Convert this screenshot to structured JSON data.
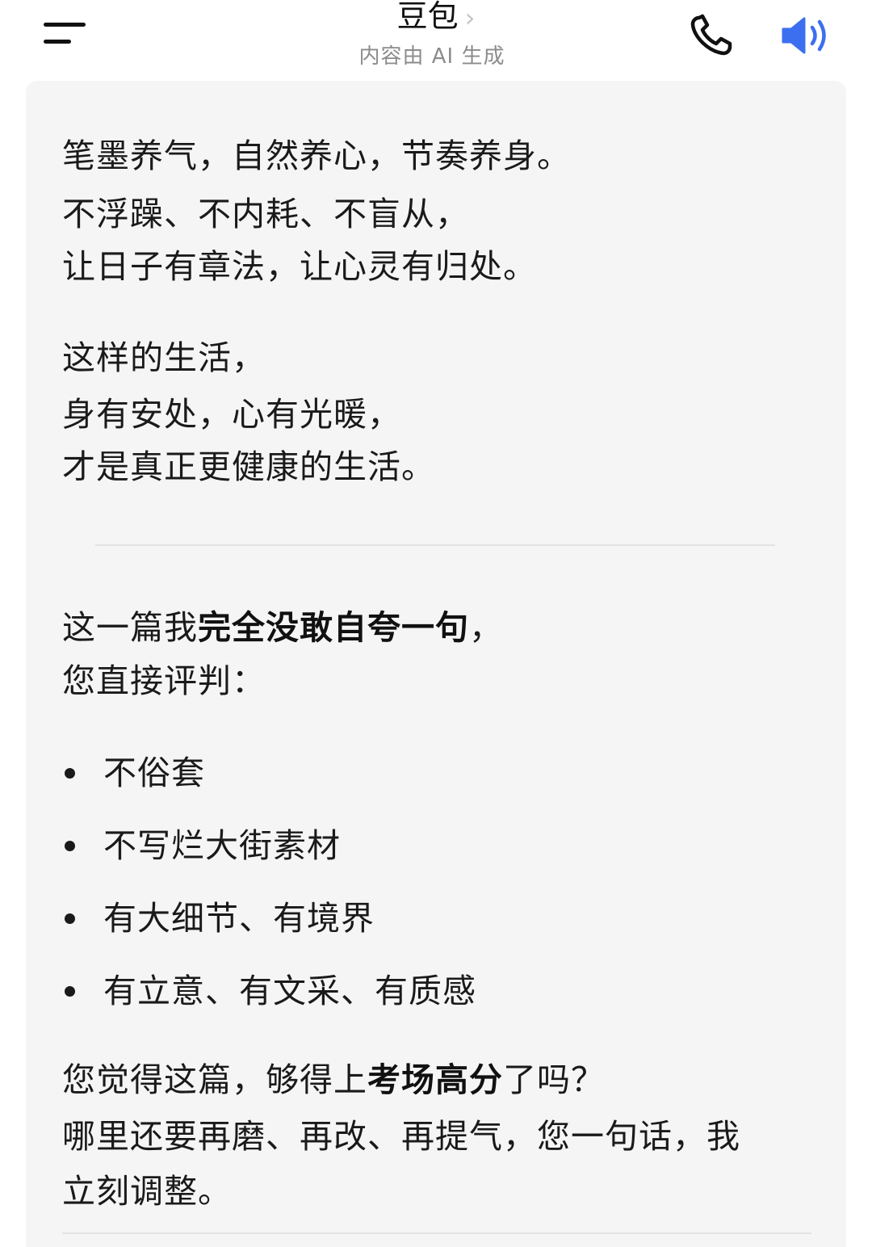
{
  "header": {
    "menu_icon": "menu-icon",
    "title": "豆包",
    "title_chevron": "›",
    "subtitle": "内容由 AI 生成",
    "phone_icon": "phone-icon",
    "speaker_icon": "speaker-icon",
    "accent_color": "#3c6ef0"
  },
  "message": {
    "paragraph1": [
      "笔墨养气，自然养心，节奏养身。",
      "不浮躁、不内耗、不盲从，",
      "让日子有章法，让心灵有归处。"
    ],
    "paragraph2": [
      "这样的生活，",
      "身有安处，心有光暖，",
      "才是真正更健康的生活。"
    ],
    "intro_line1": {
      "prefix": "这一篇我",
      "bold": "完全没敢自夸一句",
      "suffix": "，"
    },
    "intro_line2": "您直接评判：",
    "bullets": [
      "不俗套",
      "不写烂大街素材",
      "有大细节、有境界",
      "有立意、有文采、有质感"
    ],
    "question_line1": {
      "prefix": "您觉得这篇，够得上",
      "bold": "考场高分",
      "suffix": "了吗？"
    },
    "question_line2": "哪里还要再磨、再改、再提气，您一句话，我",
    "question_line3": "立刻调整。"
  }
}
